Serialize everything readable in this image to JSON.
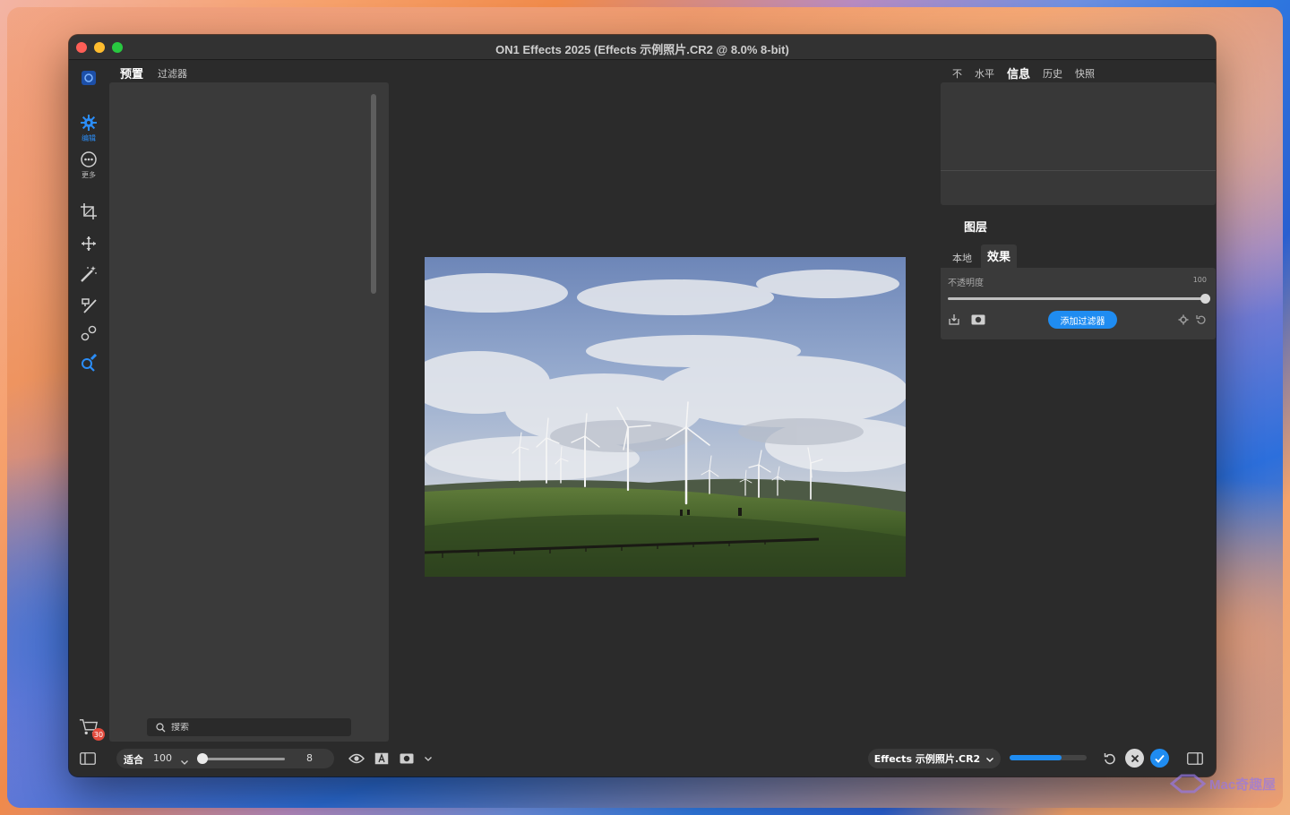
{
  "window": {
    "title": "ON1 Effects 2025 (Effects 示例照片.CR2 @ 8.0% 8-bit)"
  },
  "rail": {
    "items": [
      {
        "label": "编辑",
        "icon": "edit-gear-icon"
      },
      {
        "label": "更多",
        "icon": "more-dots-icon"
      }
    ],
    "tools": [
      "crop-icon",
      "move-icon",
      "magic-wand-icon",
      "brush-icon",
      "retouch-icon",
      "search-paint-icon"
    ],
    "cart_badge": "30"
  },
  "left_panel": {
    "tabs": [
      {
        "label": "预置"
      },
      {
        "label": "过滤器"
      }
    ],
    "search": {
      "placeholder": "搜索"
    }
  },
  "right_panel": {
    "tabs": [
      {
        "label": "不"
      },
      {
        "label": "水平"
      },
      {
        "label": "信息"
      },
      {
        "label": "历史"
      },
      {
        "label": "快照"
      }
    ],
    "layers_title": "图层",
    "layer_tabs": [
      {
        "label": "本地"
      },
      {
        "label": "效果"
      }
    ],
    "opacity": {
      "label": "不透明度",
      "value": "100"
    },
    "add_filter": "添加过滤器"
  },
  "bottom": {
    "zoom_mode": "适合",
    "zoom_value": "100",
    "zoom_num": "8",
    "file_selector": "Effects 示例照片.CR2",
    "progress": 0.68
  },
  "colors": {
    "accent": "#1f8cf1",
    "panel": "#3a3a3a",
    "bg": "#2b2b2b"
  },
  "watermark": "Mac奇趣屋"
}
